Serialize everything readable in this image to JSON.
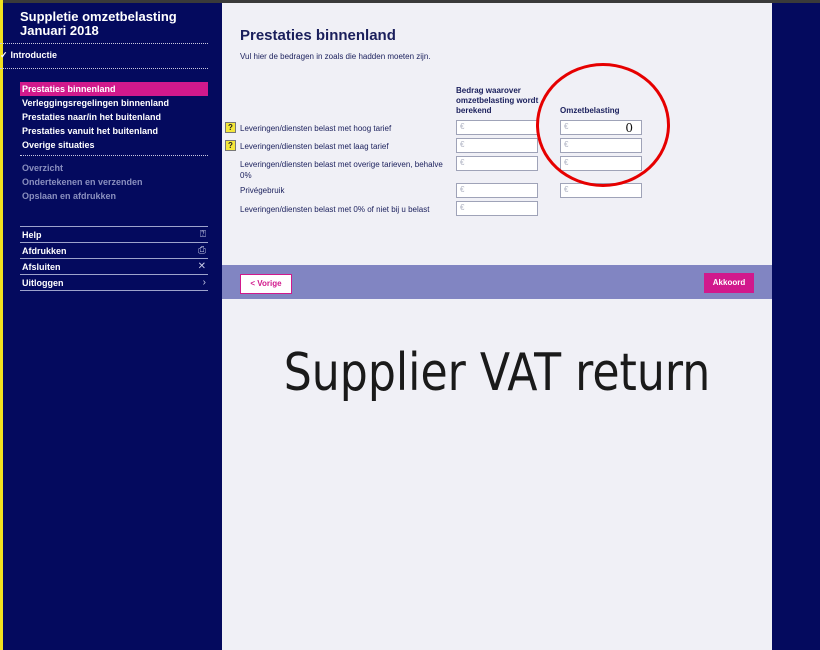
{
  "sidebar": {
    "title_line1": "Suppletie omzetbelasting",
    "title_line2": "Januari 2018",
    "intro": "Introductie",
    "items": [
      {
        "label": "Prestaties binnenland",
        "active": true
      },
      {
        "label": "Verleggingsregelingen binnenland",
        "active": false
      },
      {
        "label": "Prestaties naar/in het buitenland",
        "active": false
      },
      {
        "label": "Prestaties vanuit het buitenland",
        "active": false
      },
      {
        "label": "Overige situaties",
        "active": false
      }
    ],
    "secondary": [
      "Overzicht",
      "Ondertekenen en verzenden",
      "Opslaan en afdrukken"
    ],
    "tools": [
      {
        "label": "Help",
        "icon": "question-box-icon",
        "glyph": "⍰"
      },
      {
        "label": "Afdrukken",
        "icon": "printer-icon",
        "glyph": "⎙"
      },
      {
        "label": "Afsluiten",
        "icon": "close-icon",
        "glyph": "✕"
      },
      {
        "label": "Uitloggen",
        "icon": "chevron-right-icon",
        "glyph": "›"
      }
    ]
  },
  "main": {
    "title": "Prestaties binnenland",
    "intro": "Vul hier de bedragen in zoals die hadden moeten zijn.",
    "col_amount": "Bedrag waarover omzetbelasting wordt berekend",
    "col_vat": "Omzetbelasting",
    "currency": "€",
    "rows": [
      {
        "label": "Leveringen/diensten belast met hoog tarief",
        "help": true,
        "amount": "",
        "vat": "0"
      },
      {
        "label": "Leveringen/diensten belast met laag tarief",
        "help": true,
        "amount": "",
        "vat": ""
      },
      {
        "label": "Leveringen/diensten belast met overige tarieven, behalve 0%",
        "help": false,
        "amount": "",
        "vat": ""
      },
      {
        "label": "Privégebruik",
        "help": false,
        "amount": "",
        "vat": ""
      },
      {
        "label": "Leveringen/diensten belast met 0% of niet bij u belast",
        "help": false,
        "amount": ""
      }
    ],
    "help_glyph": "?",
    "prev_label": "< Vorige",
    "ok_label": "Akkoord",
    "caption": "Supplier VAT return"
  },
  "colors": {
    "accent": "#d1198c",
    "background": "#040a5e",
    "annotation": "#e60000"
  }
}
